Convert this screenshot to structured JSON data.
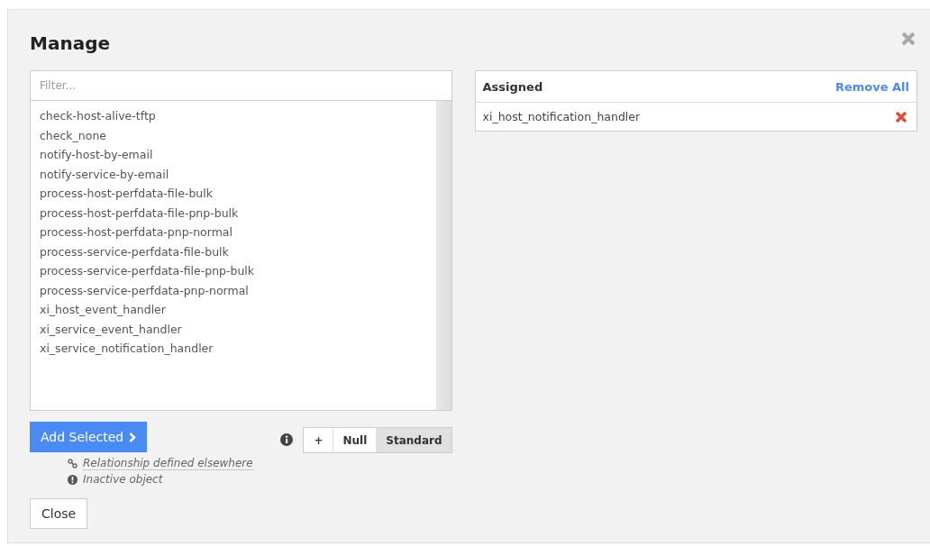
{
  "dialog": {
    "title": "Manage"
  },
  "available": {
    "filter": {
      "placeholder": "Filter..."
    },
    "items": [
      {
        "label": "check-host-alive-tftp",
        "selected": false
      },
      {
        "label": "check_none",
        "selected": false
      },
      {
        "label": "notify-host-by-email",
        "selected": false
      },
      {
        "label": "notify-service-by-email",
        "selected": false
      },
      {
        "label": "process-host-perfdata-file-bulk",
        "selected": false
      },
      {
        "label": "process-host-perfdata-file-pnp-bulk",
        "selected": false
      },
      {
        "label": "process-host-perfdata-pnp-normal",
        "selected": false
      },
      {
        "label": "process-service-perfdata-file-bulk",
        "selected": false
      },
      {
        "label": "process-service-perfdata-file-pnp-bulk",
        "selected": false
      },
      {
        "label": "process-service-perfdata-pnp-normal",
        "selected": false
      },
      {
        "label": "xi_host_event_handler",
        "selected": false
      },
      {
        "label": "xi_service_event_handler",
        "selected": false
      },
      {
        "label": "xi_service_notification_handler",
        "selected": false
      }
    ]
  },
  "add_button": "Add Selected",
  "modes": [
    {
      "label": "+",
      "selected": false
    },
    {
      "label": "Null",
      "selected": false
    },
    {
      "label": "Standard",
      "selected": true
    }
  ],
  "legend": [
    {
      "kind": "link",
      "text": "Relationship defined elsewhere"
    },
    {
      "kind": "inactive",
      "text": "Inactive object"
    }
  ],
  "close_button": "Close",
  "assigned": {
    "title": "Assigned",
    "remove_all": "Remove All",
    "items": [
      {
        "label": "xi_host_notification_handler"
      }
    ]
  }
}
